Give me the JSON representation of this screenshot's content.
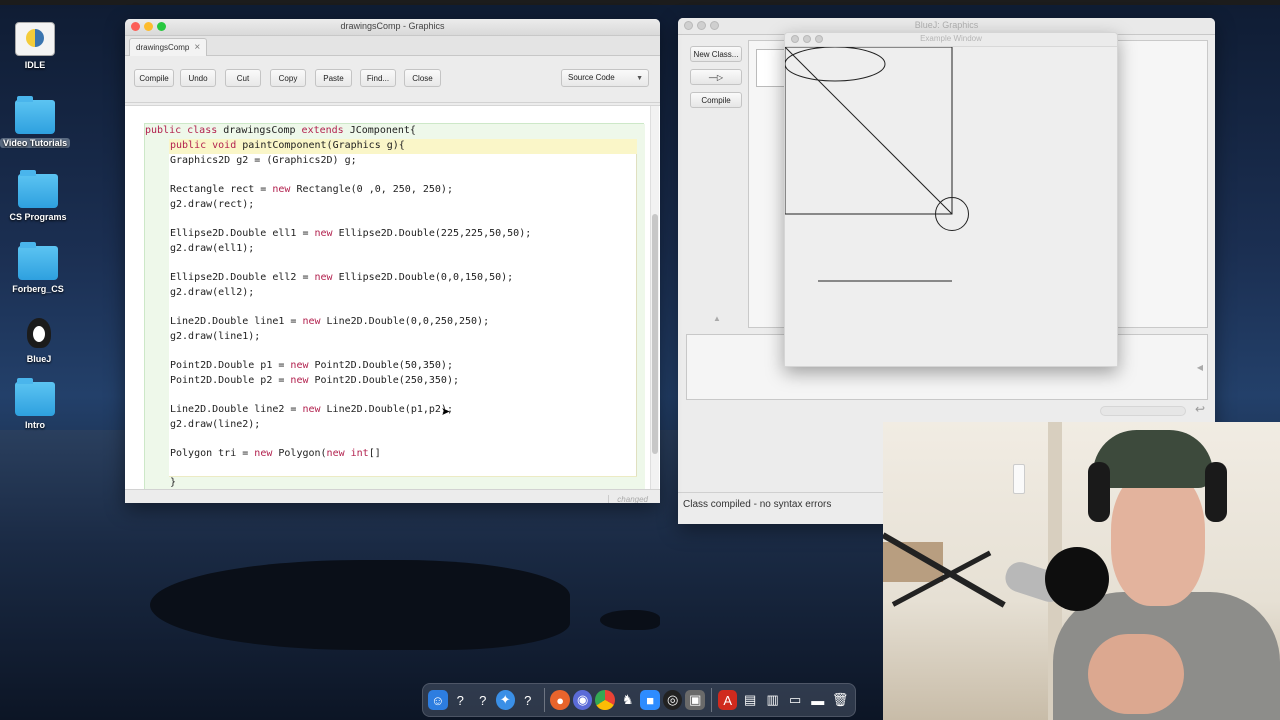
{
  "desktop": {
    "icons": [
      {
        "label": "IDLE"
      },
      {
        "label": "Video Tutorials"
      },
      {
        "label": "CS Programs"
      },
      {
        "label": "Forberg_CS"
      },
      {
        "label": "BlueJ"
      },
      {
        "label": "Intro"
      }
    ]
  },
  "editor": {
    "window_title": "drawingsComp - Graphics",
    "tab_label": "drawingsComp",
    "toolbar": {
      "compile": "Compile",
      "undo": "Undo",
      "cut": "Cut",
      "copy": "Copy",
      "paste": "Paste",
      "find": "Find...",
      "close": "Close",
      "view_select": "Source Code"
    },
    "code": {
      "l1_a": "public class",
      "l1_b": " drawingsComp ",
      "l1_c": "extends",
      "l1_d": " JComponent{",
      "l2_a": "public void",
      "l2_b": " paintComponent(Graphics g){",
      "l3": "Graphics2D g2 = (Graphics2D) g;",
      "l4_a": "Rectangle rect = ",
      "l4_b": "new",
      "l4_c": " Rectangle(0 ,0, 250, 250);",
      "l5": "g2.draw(rect);",
      "l6_a": "Ellipse2D.Double ell1 = ",
      "l6_b": "new",
      "l6_c": " Ellipse2D.Double(225,225,50,50);",
      "l7": "g2.draw(ell1);",
      "l8_a": "Ellipse2D.Double ell2 = ",
      "l8_b": "new",
      "l8_c": " Ellipse2D.Double(0,0,150,50);",
      "l9": "g2.draw(ell2);",
      "l10_a": "Line2D.Double line1 = ",
      "l10_b": "new",
      "l10_c": " Line2D.Double(0,0,250,250);",
      "l11": "g2.draw(line1);",
      "l12_a": "Point2D.Double p1 = ",
      "l12_b": "new",
      "l12_c": " Point2D.Double(50,350);",
      "l13_a": "Point2D.Double p2 = ",
      "l13_b": "new",
      "l13_c": " Point2D.Double(250,350);",
      "l14_a": "Line2D.Double line2 = ",
      "l14_b": "new",
      "l14_c": " Line2D.Double(p1,p2);",
      "l15": "g2.draw(line2);",
      "l16_a": "Polygon tri = ",
      "l16_b": "new",
      "l16_c": " Polygon(",
      "l16_d": "new",
      "l16_e": " ",
      "l16_f": "int",
      "l16_g": "[]",
      "l17": "}"
    },
    "status_text": "changed"
  },
  "bluej": {
    "window_title": "BlueJ: Graphics",
    "buttons": {
      "new_class": "New Class...",
      "arrow": "—▷",
      "compile": "Compile"
    },
    "status": "Class compiled - no syntax errors"
  },
  "example_window": {
    "title": "Example Window"
  },
  "colors": {
    "keyword": "#b2214e",
    "class_band": "#eef8ea",
    "method_band": "#fffff2"
  }
}
